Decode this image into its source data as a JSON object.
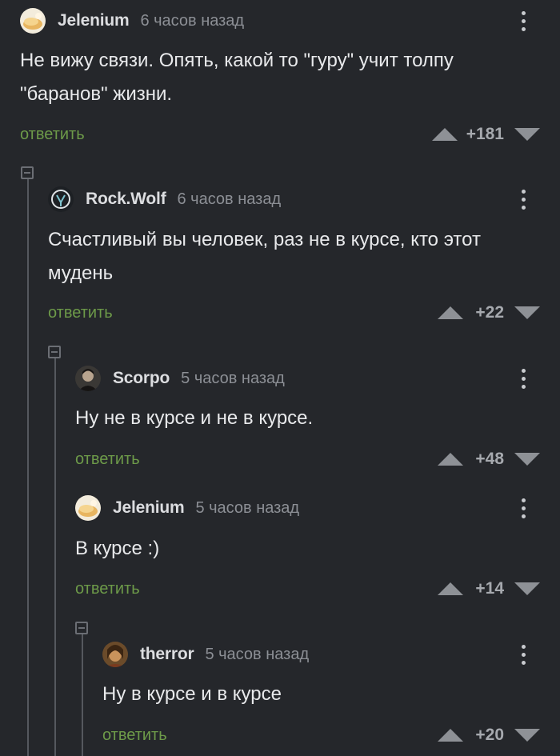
{
  "comments": [
    {
      "author": "Jelenium",
      "time": "6 часов назад",
      "text": "Не вижу связи. Опять,  какой то \"гуру\" учит толпу \"баранов\" жизни.",
      "reply": "ответить",
      "score": "+181",
      "avatar": "bread-avatar"
    },
    {
      "author": "Rock.Wolf",
      "time": "6 часов назад",
      "text": "Счастливый вы человек, раз не в курсе, кто этот мудень",
      "reply": "ответить",
      "score": "+22",
      "avatar": "wolf-logo-avatar"
    },
    {
      "author": "Scorpo",
      "time": "5 часов назад",
      "text": "Ну не в курсе и не в курсе.",
      "reply": "ответить",
      "score": "+48",
      "avatar": "portrait-avatar"
    },
    {
      "author": "Jelenium",
      "time": "5 часов назад",
      "text": "В курсе :)",
      "reply": "ответить",
      "score": "+14",
      "avatar": "bread-avatar"
    },
    {
      "author": "therror",
      "time": "5 часов назад",
      "text": "Ну в курсе и в курсе",
      "reply": "ответить",
      "score": "+20",
      "avatar": "painting-avatar"
    }
  ],
  "colors": {
    "background": "#25272b",
    "reply_link": "#6d9a49",
    "text": "#e8e9eb",
    "meta": "#8c8f95"
  }
}
